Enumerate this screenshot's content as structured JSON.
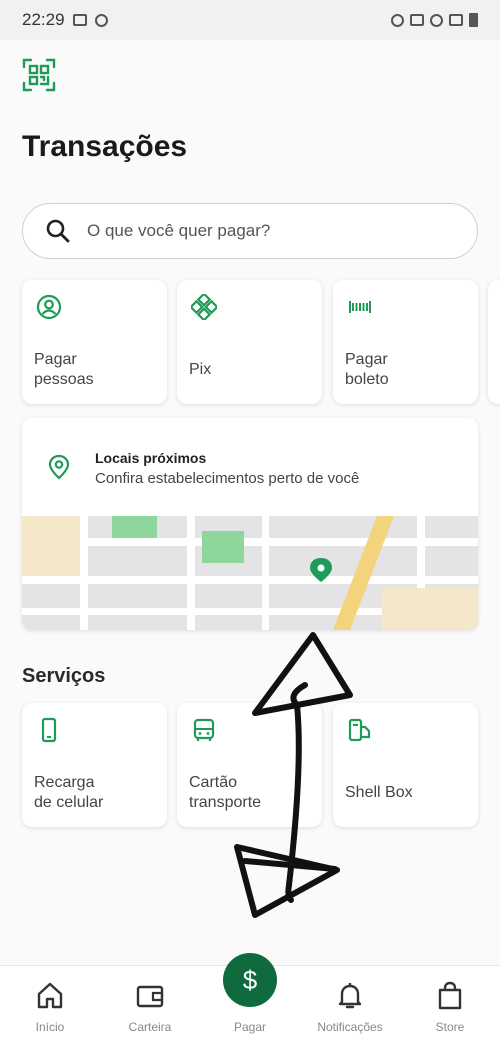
{
  "status_bar": {
    "time": "22:29"
  },
  "header": {
    "qr_icon": "qr-scan-icon",
    "title": "Transações"
  },
  "search": {
    "placeholder": "O que você quer pagar?"
  },
  "quick_actions": [
    {
      "label_line1": "Pagar",
      "label_line2": "pessoas",
      "icon": "person-icon"
    },
    {
      "label_line1": "Pix",
      "label_line2": "",
      "icon": "pix-icon"
    },
    {
      "label_line1": "Pagar",
      "label_line2": "boleto",
      "icon": "barcode-icon"
    }
  ],
  "nearby": {
    "title": "Locais próximos",
    "subtitle": "Confira estabelecimentos perto de você",
    "icon": "location-pin-icon"
  },
  "services": {
    "title": "Serviços",
    "items": [
      {
        "label_line1": "Recarga",
        "label_line2": "de celular",
        "icon": "phone-icon"
      },
      {
        "label_line1": "Cartão",
        "label_line2": "transporte",
        "icon": "bus-icon"
      },
      {
        "label_line1": "Shell Box",
        "label_line2": "",
        "icon": "shell-box-icon"
      }
    ]
  },
  "bottom_nav": [
    {
      "label": "Início",
      "icon": "home-icon"
    },
    {
      "label": "Carteira",
      "icon": "wallet-icon"
    },
    {
      "label": "Pagar",
      "icon": "dollar-icon",
      "symbol": "$"
    },
    {
      "label": "Notificações",
      "icon": "bell-icon"
    },
    {
      "label": "Store",
      "icon": "shopping-bag-icon"
    }
  ],
  "colors": {
    "accent": "#1e9b57",
    "pay_button": "#0f6b3d",
    "map_green": "#8ed69c",
    "map_road": "#f3d37c"
  }
}
